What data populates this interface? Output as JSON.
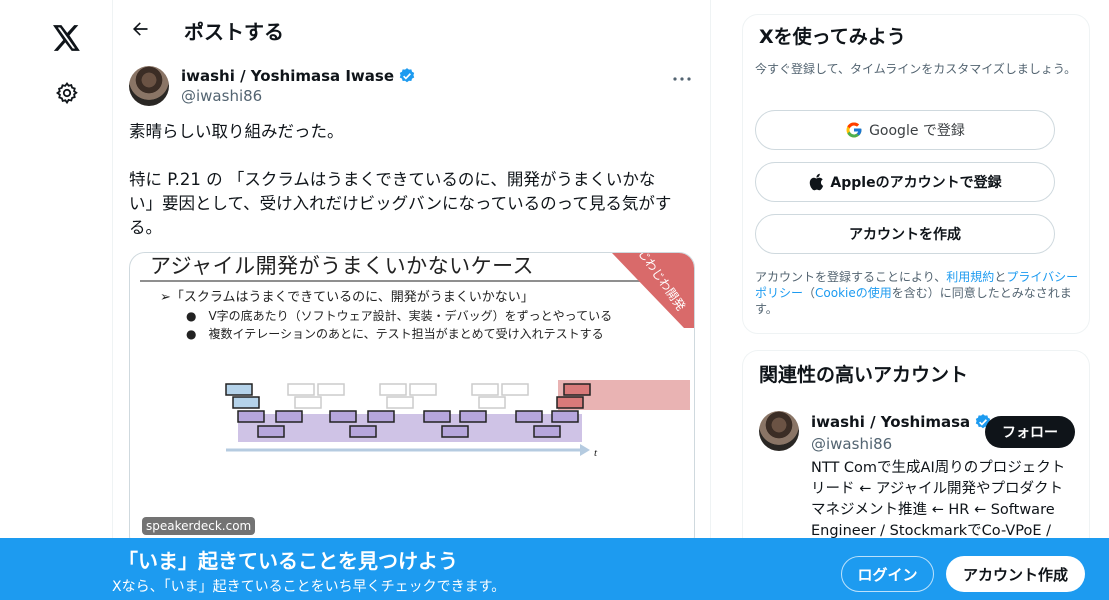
{
  "nav": {
    "logo_icon": "x-logo-icon",
    "settings_icon": "gear-icon"
  },
  "header": {
    "title": "ポストする",
    "back_icon": "arrow-left-icon"
  },
  "post": {
    "author_name": "iwashi / Yoshimasa Iwase",
    "author_handle": "@iwashi86",
    "line1": "素晴らしい取り組みだった。",
    "line2": "特に P.21 の 「スクラムはうまくできているのに、開発がうまくいかな",
    "line3": "い」要因として、受け入れだけビッグバンになっているのって見る気がす",
    "line4": "る。",
    "media": {
      "slide_title": "アジャイル開発がうまくいかないケース",
      "bullet1": "➢「スクラムはうまくできているのに、開発がうまくいかない」",
      "bullet2": "●　V字の底あたり（ソフトウェア設計、実装・デバッグ）をずっとやっている",
      "bullet3": "●　複数イテレーションのあとに、テスト担当がまとめて受け入れテストする",
      "ribbon": "じわじわ開発",
      "axis_label": "t",
      "watermark": "speakerdeck.com"
    }
  },
  "signup_card": {
    "title": "Xを使ってみよう",
    "subtitle": "今すぐ登録して、タイムラインをカスタマイズしましょう。",
    "google_label": "Google で登録",
    "apple_label": "Appleのアカウントで登録",
    "create_label": "アカウントを作成",
    "legal_pre": "アカウントを登録することにより、",
    "terms_link": "利用規約",
    "legal_and": "と",
    "privacy_link": "プライバシーポリシー",
    "legal_mid": "（",
    "cookie_link": "Cookieの使用",
    "legal_post": "を含む）に同意したとみなされます。"
  },
  "related": {
    "title": "関連性の高いアカウント",
    "name": "iwashi / Yoshimasa",
    "handle": "@iwashi86",
    "follow_label": "フォロー",
    "bio": "NTT Comで生成AI周りのプロジェクトリード ← アジャイル開発やプロダクトマネジメント推進 ← HR ← Software Engineer / StockmarkでCo-VPoE /"
  },
  "banner": {
    "title": "「いま」起きていることを見つけよう",
    "subtitle": "Xなら、「いま」起きていることをいち早くチェックできます。",
    "login_label": "ログイン",
    "signup_label": "アカウント作成"
  },
  "colors": {
    "accent": "#1d9bf0",
    "text": "#0f1419",
    "muted": "#536471"
  }
}
